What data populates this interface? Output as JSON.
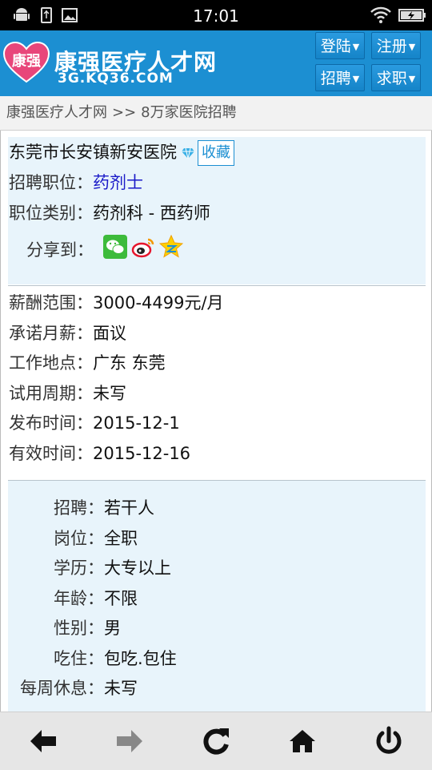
{
  "status_bar": {
    "time": "17:01"
  },
  "header": {
    "logo_main": "康强医疗人才网",
    "logo_sub": "3G.KQ36.COM",
    "logo_heart_text": "康强",
    "buttons": {
      "login": "登陆",
      "register": "注册",
      "recruit": "招聘",
      "job_seek": "求职"
    }
  },
  "breadcrumb": {
    "home": "康强医疗人才网",
    "separator": ">>",
    "current": "8万家医院招聘"
  },
  "job": {
    "hospital": "东莞市长安镇新安医院",
    "favorite_label": "收藏",
    "position_label": "招聘职位：",
    "position_value": "药剂士",
    "category_label": "职位类别：",
    "category_value": "药剂科 - 西药师",
    "share_label": "分享到："
  },
  "details": [
    {
      "label": "薪酬范围：",
      "value": "3000-4499元/月"
    },
    {
      "label": "承诺月薪：",
      "value": "面议"
    },
    {
      "label": "工作地点：",
      "value": "广东 东莞"
    },
    {
      "label": "试用周期：",
      "value": "未写"
    },
    {
      "label": "发布时间：",
      "value": "2015-12-1"
    },
    {
      "label": "有效时间：",
      "value": "2015-12-16"
    }
  ],
  "requirements": [
    {
      "label": "招聘：",
      "value": "若干人"
    },
    {
      "label": "岗位：",
      "value": "全职"
    },
    {
      "label": "学历：",
      "value": "大专以上"
    },
    {
      "label": "年龄：",
      "value": "不限"
    },
    {
      "label": "性别：",
      "value": "男"
    },
    {
      "label": "吃住：",
      "value": "包吃.包住"
    },
    {
      "label": "每周休息：",
      "value": "未写"
    }
  ],
  "colors": {
    "header_blue": "#1c8fd2",
    "logo_pink": "#e8467a",
    "link_blue": "#1a1ac8",
    "panel_bg": "#e8f4fb"
  }
}
